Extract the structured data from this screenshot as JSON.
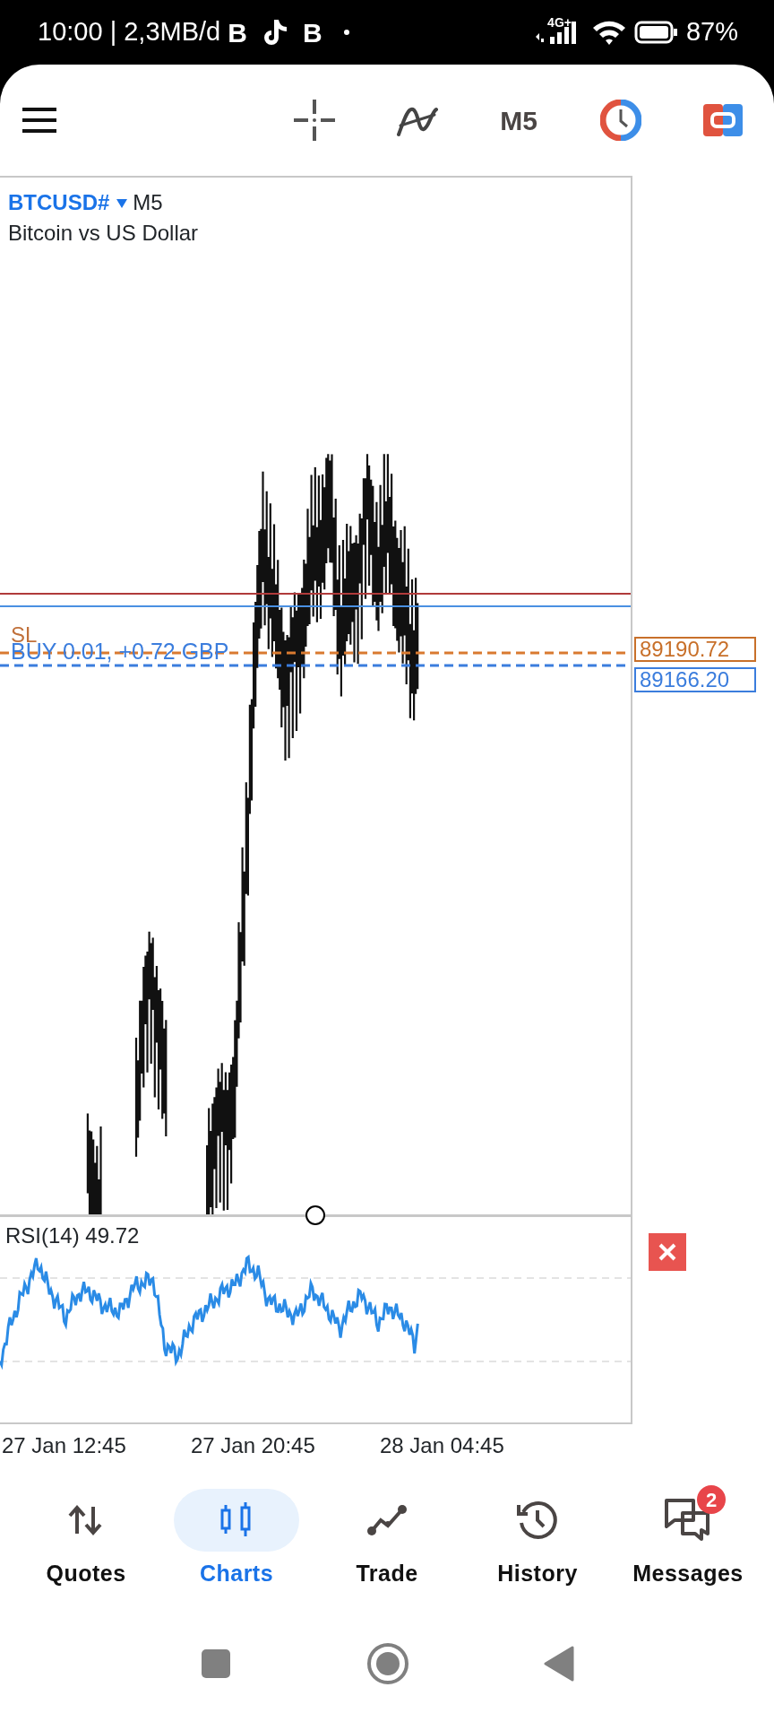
{
  "status_bar": {
    "time_and_data": "10:00 | 2,3MB/d",
    "app_letters": [
      "B",
      "B"
    ],
    "network": "4G+",
    "battery": "87%"
  },
  "toolbar": {
    "timeframe": "M5"
  },
  "chart": {
    "symbol": "BTCUSD#",
    "timeframe": "M5",
    "description": "Bitcoin vs US Dollar",
    "sl_label": "SL",
    "order_label": "BUY 0.01,  +0.72 GBP",
    "price_tags": [
      {
        "text": "89190.72",
        "color": "#c8702a"
      },
      {
        "text": "89166.20",
        "color": "#3b7ddd"
      }
    ]
  },
  "indicator": {
    "label": "RSI(14) 49.72"
  },
  "time_axis": [
    "27 Jan 12:45",
    "27 Jan 20:45",
    "28 Jan 04:45"
  ],
  "nav": [
    {
      "kind": "quotes",
      "label": "Quotes",
      "selected": false
    },
    {
      "kind": "charts",
      "label": "Charts",
      "selected": true
    },
    {
      "kind": "trade",
      "label": "Trade",
      "selected": false
    },
    {
      "kind": "history",
      "label": "History",
      "selected": false
    },
    {
      "kind": "messages",
      "label": "Messages",
      "selected": false,
      "badge": "2"
    }
  ]
}
